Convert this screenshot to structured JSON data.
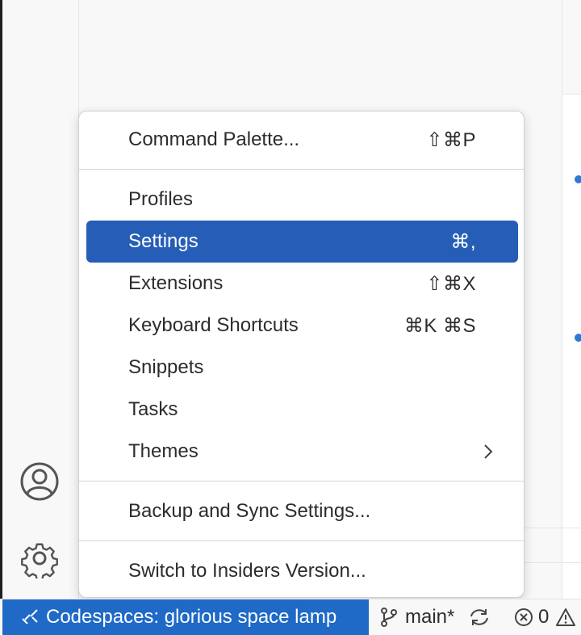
{
  "menu": {
    "items": [
      {
        "label": "Command Palette...",
        "shortcut": "⇧⌘P"
      },
      {
        "label": "Profiles",
        "shortcut": ""
      },
      {
        "label": "Settings",
        "shortcut": "⌘,"
      },
      {
        "label": "Extensions",
        "shortcut": "⇧⌘X"
      },
      {
        "label": "Keyboard Shortcuts",
        "shortcut": "⌘K ⌘S"
      },
      {
        "label": "Snippets",
        "shortcut": ""
      },
      {
        "label": "Tasks",
        "shortcut": ""
      },
      {
        "label": "Themes",
        "shortcut": ""
      },
      {
        "label": "Backup and Sync Settings...",
        "shortcut": ""
      },
      {
        "label": "Switch to Insiders Version...",
        "shortcut": ""
      }
    ],
    "active_item": "Settings",
    "themes_has_submenu": true
  },
  "activity_bar": {
    "icons": [
      "accounts-icon",
      "manage-gear-icon"
    ]
  },
  "statusbar": {
    "remote_label": "Codespaces: glorious space lamp",
    "branch": "main*",
    "errors": "0"
  },
  "colors": {
    "accent": "#265eb7",
    "remote_bg": "#1f6ac7"
  }
}
